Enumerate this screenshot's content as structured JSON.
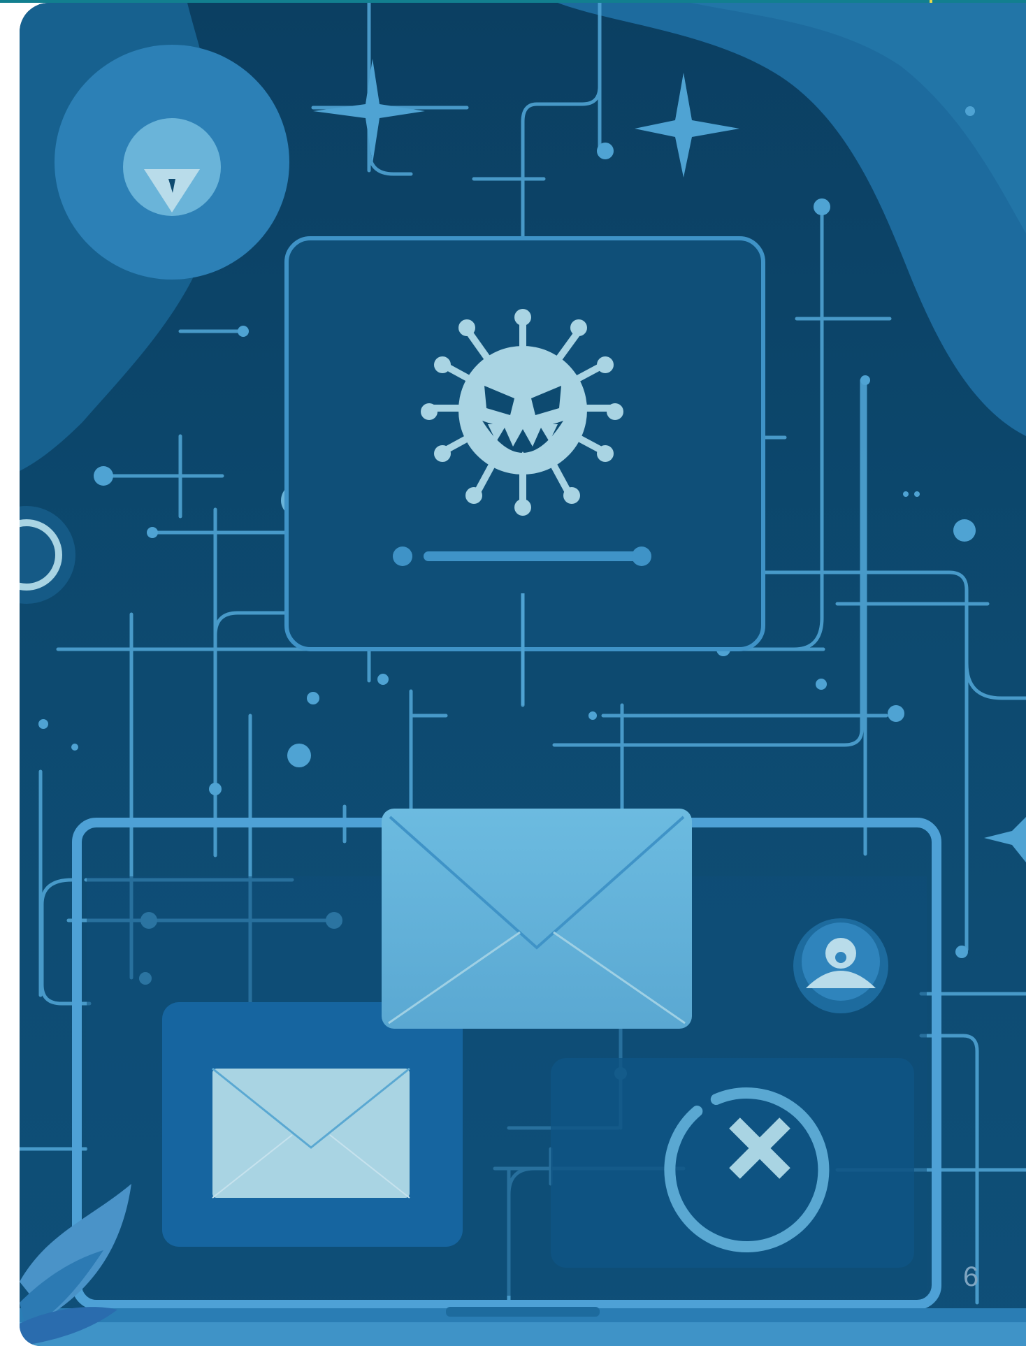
{
  "slide": {
    "page_number": "6"
  },
  "illustration": {
    "subject": "email-malware-threat",
    "icons": [
      "virus-icon",
      "envelope-icon",
      "envelope-small-icon",
      "user-avatar-icon",
      "close-circle-icon",
      "shield-warning-icon",
      "sparkle-icon",
      "leaf-icon"
    ]
  },
  "colors": {
    "top_bar": "#127f8f",
    "top_accent": "#e9d94a",
    "background_dark": "#0d4a6e",
    "background_blob": "#1f6fa1",
    "line_light": "#4fa3d3",
    "icon_light": "#a9d4e3",
    "envelope": "#63b3d8",
    "page_number": "#7fa5c1"
  }
}
